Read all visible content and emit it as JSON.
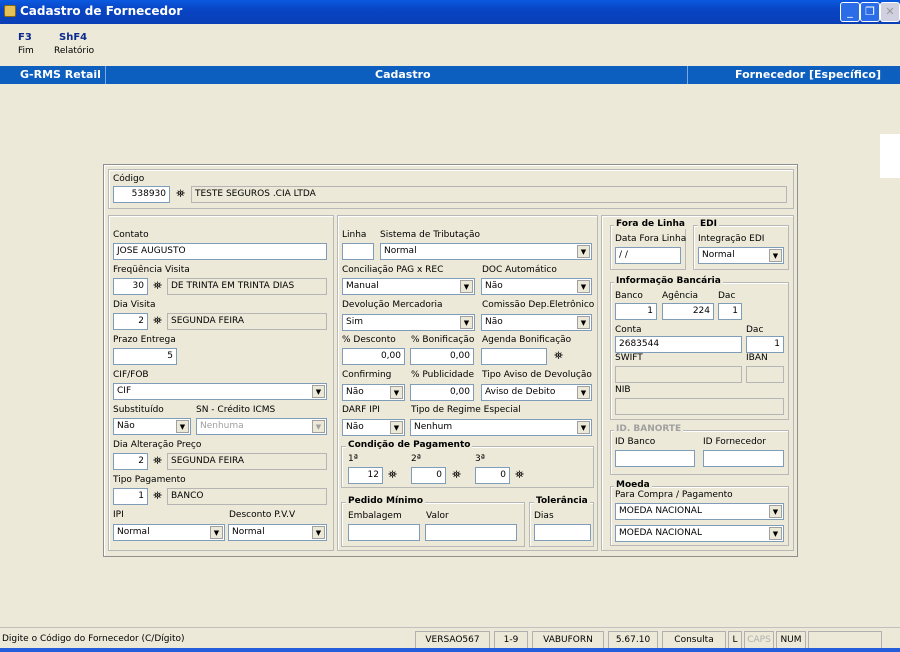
{
  "window": {
    "title": "Cadastro de Fornecedor"
  },
  "fkeys": [
    {
      "key": "F3",
      "label": "Fim"
    },
    {
      "key": "ShF4",
      "label": "Relatório"
    }
  ],
  "navbar": {
    "app": "G-RMS Retail",
    "section": "Cadastro",
    "context": "Fornecedor [Específico]"
  },
  "codigo": {
    "label": "Código",
    "value": "538930",
    "name": "TESTE SEGUROS .CIA LTDA"
  },
  "left": {
    "contato_label": "Contato",
    "contato": "JOSE AUGUSTO",
    "freq_label": "Freqüência Visita",
    "freq_num": "30",
    "freq_desc": "DE TRINTA EM TRINTA DIAS",
    "dia_label": "Dia Visita",
    "dia_num": "2",
    "dia_desc": "SEGUNDA FEIRA",
    "prazo_label": "Prazo Entrega",
    "prazo": "5",
    "cif_label": "CIF/FOB",
    "cif": "CIF",
    "subst_label": "Substituído",
    "subst": "Não",
    "sn_label": "SN - Crédito ICMS",
    "sn": "Nenhuma",
    "alter_label": "Dia Alteração Preço",
    "alter_num": "2",
    "alter_desc": "SEGUNDA FEIRA",
    "tipo_label": "Tipo Pagamento",
    "tipo_num": "1",
    "tipo_desc": "BANCO",
    "ipi_label": "IPI",
    "ipi": "Normal",
    "desc_label": "Desconto P.V.V",
    "desc": "Normal"
  },
  "middle": {
    "linha_label": "Linha",
    "linha": "",
    "trib_label": "Sistema de Tributação",
    "trib": "Normal",
    "conc_label": "Conciliação PAG x REC",
    "conc": "Manual",
    "doc_label": "DOC Automático",
    "doc": "Não",
    "devol_label": "Devolução Mercadoria",
    "devol": "Sim",
    "comis_label": "Comissão Dep.Eletrônico",
    "comis": "Não",
    "pdesc_label": "% Desconto",
    "pdesc": "0,00",
    "pbon_label": "% Bonificação",
    "pbon": "0,00",
    "agbon_label": "Agenda Bonificação",
    "agbon": "",
    "confirming_label": "Confirming",
    "confirming": "Não",
    "ppub_label": "% Publicidade",
    "ppub": "0,00",
    "aviso_label": "Tipo Aviso de Devolução",
    "aviso": "Aviso de Debito",
    "darf_label": "DARF IPI",
    "darf": "Não",
    "regime_label": "Tipo de Regime Especial",
    "regime": "Nenhum",
    "cond_title": "Condição de Pagamento",
    "c1_label": "1ª",
    "c1": "12",
    "c2_label": "2ª",
    "c2": "0",
    "c3_label": "3ª",
    "c3": "0",
    "pedido_title": "Pedido Mínimo",
    "emb_label": "Embalagem",
    "emb": "",
    "valor_label": "Valor",
    "valor": "",
    "tol_title": "Tolerância",
    "dias_label": "Dias",
    "dias": ""
  },
  "right": {
    "fora_title": "Fora de Linha",
    "fora_label": "Data Fora Linha",
    "fora": " / /",
    "edi_title": "EDI",
    "edi_label": "Integração EDI",
    "edi": "Normal",
    "banc_title": "Informação Bancária",
    "banco_label": "Banco",
    "banco": "1",
    "agencia_label": "Agência",
    "agencia": "224",
    "dac_label": "Dac",
    "dac1": "1",
    "conta_label": "Conta",
    "conta": "2683544",
    "dac2_label": "Dac",
    "dac2": "1",
    "swift_label": "SWIFT",
    "iban_label": "IBAN",
    "nib_label": "NIB",
    "banorte_title": "ID. BANORTE",
    "idbanco_label": "ID Banco",
    "idforn_label": "ID Fornecedor",
    "moeda_title": "Moeda",
    "moeda_label": "Para Compra / Pagamento",
    "moeda1": "MOEDA NACIONAL",
    "moeda2": "MOEDA NACIONAL"
  },
  "status": {
    "hint": "Digite o Código do Fornecedor (C/Dígito)",
    "versao": "VERSAO567",
    "range": "1-9",
    "program": "VABUFORN",
    "build": "5.67.10",
    "mode": "Consulta",
    "l": "L",
    "caps": "CAPS",
    "num": "NUM"
  },
  "icons": {
    "binoculars": "binoculars-icon",
    "dropdown": "chevron-down-icon"
  }
}
